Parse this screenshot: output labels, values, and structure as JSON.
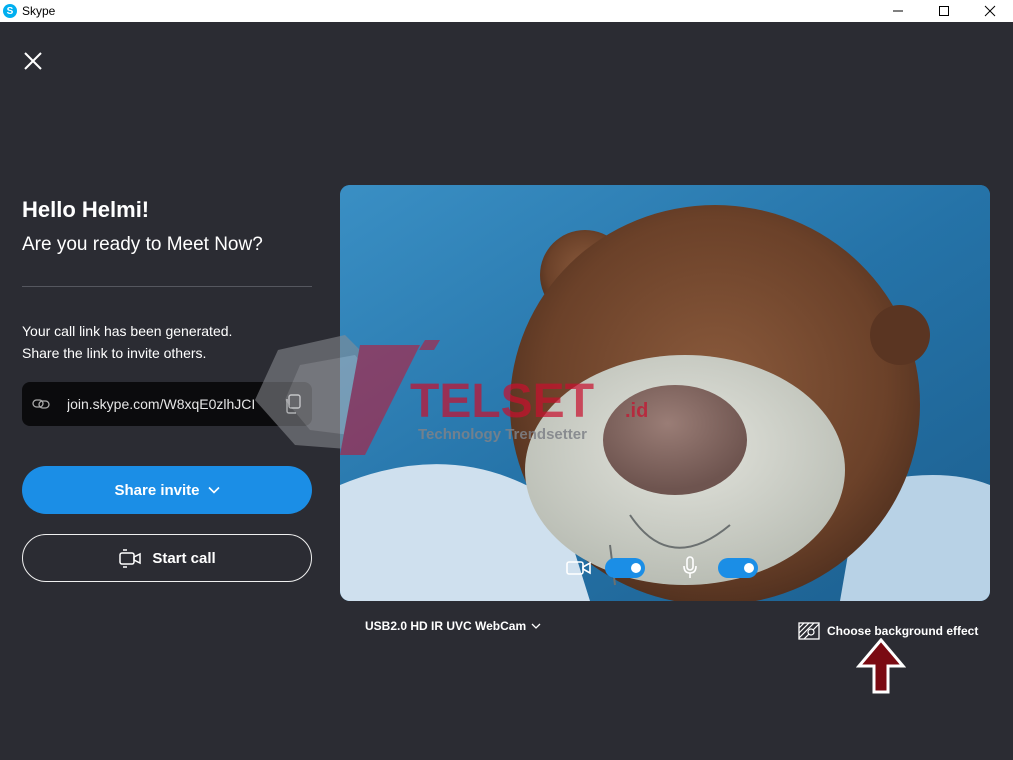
{
  "window": {
    "title": "Skype",
    "app_icon_letter": "S"
  },
  "greeting": {
    "title": "Hello Helmi!",
    "subtitle": "Are you ready to Meet Now?"
  },
  "info": {
    "line1": "Your call link has been generated.",
    "line2": "Share the link to invite others."
  },
  "call_link": {
    "value": "join.skype.com/W8xqE0zlhJCI"
  },
  "buttons": {
    "share_invite": "Share invite",
    "start_call": "Start call"
  },
  "video_controls": {
    "camera_on": true,
    "mic_on": true
  },
  "camera_select": {
    "selected": "USB2.0 HD IR UVC WebCam"
  },
  "background_effect": {
    "label": "Choose background effect"
  },
  "watermark": {
    "brand": "TELSET",
    "suffix": ".id",
    "tagline": "Technology Trendsetter"
  },
  "colors": {
    "background": "#2b2c33",
    "accent": "#1b8ee6",
    "link_box": "#0b0b0d",
    "watermark_red": "#c8102e"
  }
}
